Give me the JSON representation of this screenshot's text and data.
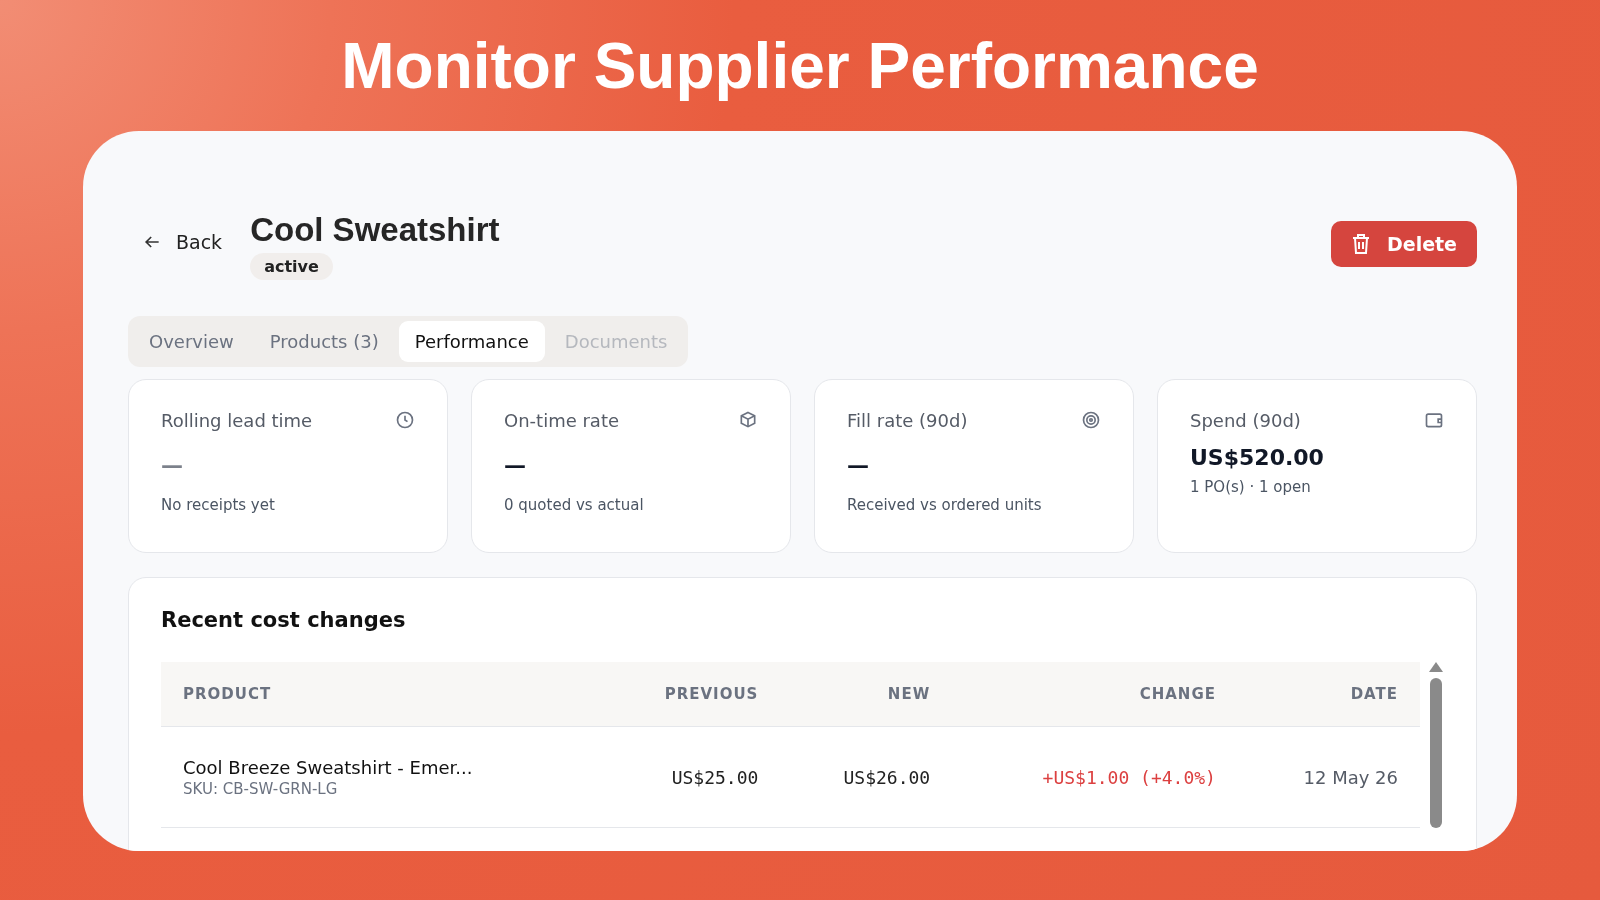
{
  "headline": "Monitor Supplier Performance",
  "back": {
    "label": "Back"
  },
  "title": "Cool Sweatshirt",
  "status": "active",
  "delete_button": "Delete",
  "tabs": [
    {
      "label": "Overview",
      "selected": false,
      "disabled": false
    },
    {
      "label": "Products (3)",
      "selected": false,
      "disabled": false
    },
    {
      "label": "Performance",
      "selected": true,
      "disabled": false
    },
    {
      "label": "Documents",
      "selected": false,
      "disabled": true
    }
  ],
  "metrics": [
    {
      "label": "Rolling lead time",
      "value": "—",
      "muted": true,
      "note": "No receipts yet"
    },
    {
      "label": "On-time rate",
      "value": "—",
      "muted": false,
      "note": "0 quoted vs actual"
    },
    {
      "label": "Fill rate (90d)",
      "value": "—",
      "muted": false,
      "note": "Received vs ordered units"
    },
    {
      "label": "Spend (90d)",
      "value": "US$520.00",
      "muted": false,
      "note": "1 PO(s) · 1 open"
    }
  ],
  "cost_changes": {
    "title": "Recent cost changes",
    "columns": [
      "PRODUCT",
      "PREVIOUS",
      "NEW",
      "CHANGE",
      "DATE"
    ],
    "rows": [
      {
        "product": "Cool Breeze Sweatshirt - Emer...",
        "sku": "SKU: CB-SW-GRN-LG",
        "previous": "US$25.00",
        "new": "US$26.00",
        "change": "+US$1.00 (+4.0%)",
        "date": "12 May 26"
      }
    ]
  }
}
